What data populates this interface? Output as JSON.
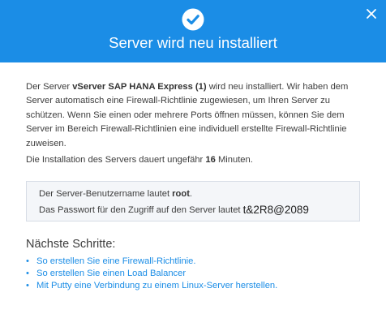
{
  "dialog": {
    "title": "Server wird neu installiert",
    "accent_color": "#1b8de6",
    "icons": {
      "status": "check-circle-icon",
      "close": "close-icon"
    }
  },
  "message": {
    "p1_a": "Der Server ",
    "p1_server": "vServer SAP HANA Express (1)",
    "p1_b": " wird neu installiert. Wir haben dem Server automatisch eine Firewall-Richtlinie zugewiesen, um Ihren Server zu schützen. Wenn Sie einen oder mehrere Ports öffnen müssen, können Sie dem Server im Bereich Firewall-Richtlinien eine individuell erstellte Firewall-Richtlinie zuweisen.",
    "p2_a": "Die Installation des Servers dauert ungefähr ",
    "p2_minutes": "16",
    "p2_b": " Minuten."
  },
  "credentials": {
    "user_label": "Der Server-Benutzername lautet ",
    "username": "root",
    "user_suffix": ".",
    "password_label": "Das Passwort für den Zugriff auf den Server lautet ",
    "password": "t&2R8@2089"
  },
  "next_steps": {
    "title": "Nächste Schritte:",
    "bullet": "•",
    "items": [
      "So erstellen Sie eine Firewall-Richtlinie.",
      "So erstellen Sie einen Load Balancer",
      "Mit Putty eine Verbindung zu einem Linux-Server herstellen."
    ]
  }
}
